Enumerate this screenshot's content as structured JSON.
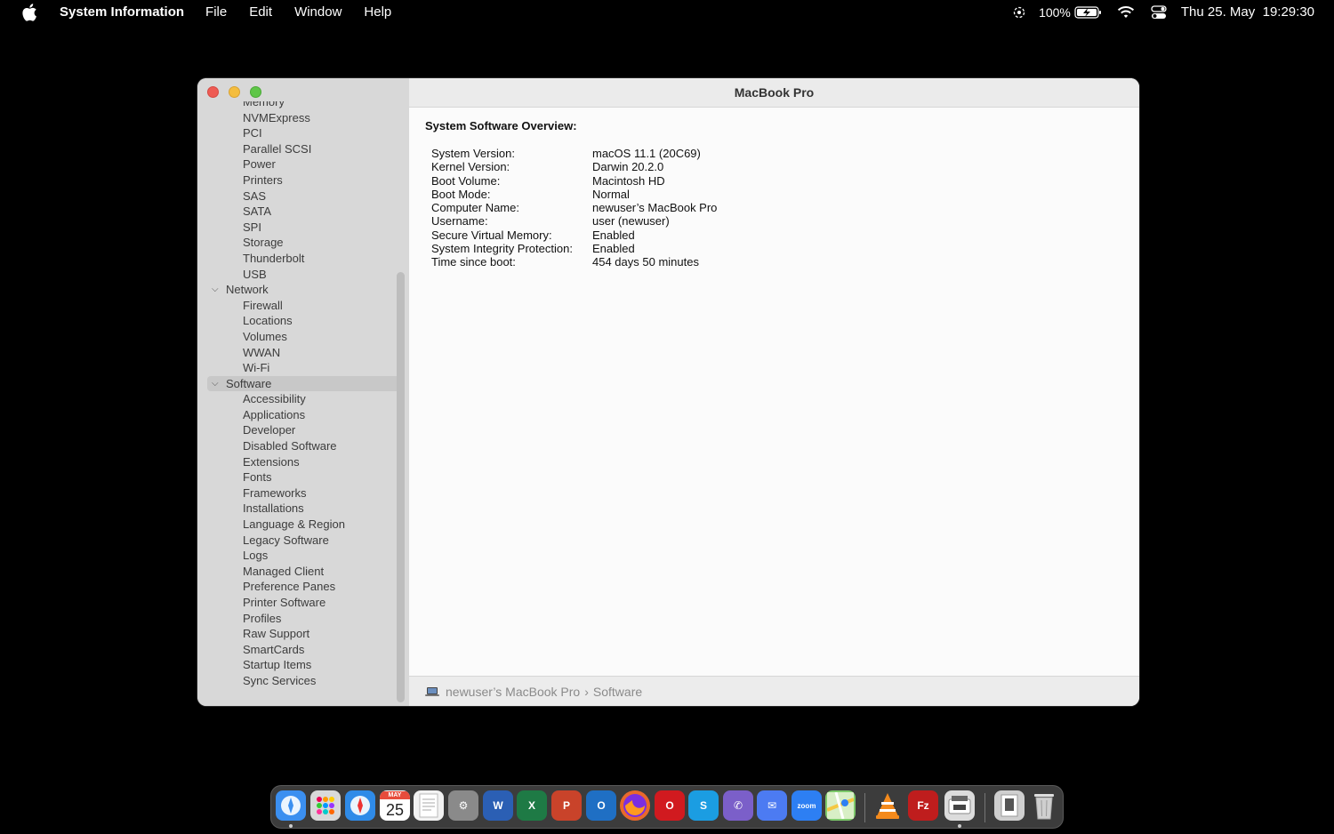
{
  "menubar": {
    "app_name": "System Information",
    "items": [
      "File",
      "Edit",
      "Window",
      "Help"
    ],
    "battery": "100%",
    "date": "Thu 25. May",
    "time": "19:29:30"
  },
  "window": {
    "title": "MacBook Pro",
    "sidebar": {
      "items": [
        {
          "label": "Memory",
          "type": "child"
        },
        {
          "label": "NVMExpress",
          "type": "child"
        },
        {
          "label": "PCI",
          "type": "child"
        },
        {
          "label": "Parallel SCSI",
          "type": "child"
        },
        {
          "label": "Power",
          "type": "child"
        },
        {
          "label": "Printers",
          "type": "child"
        },
        {
          "label": "SAS",
          "type": "child"
        },
        {
          "label": "SATA",
          "type": "child"
        },
        {
          "label": "SPI",
          "type": "child"
        },
        {
          "label": "Storage",
          "type": "child"
        },
        {
          "label": "Thunderbolt",
          "type": "child"
        },
        {
          "label": "USB",
          "type": "child"
        },
        {
          "label": "Network",
          "type": "group"
        },
        {
          "label": "Firewall",
          "type": "child"
        },
        {
          "label": "Locations",
          "type": "child"
        },
        {
          "label": "Volumes",
          "type": "child"
        },
        {
          "label": "WWAN",
          "type": "child"
        },
        {
          "label": "Wi-Fi",
          "type": "child"
        },
        {
          "label": "Software",
          "type": "group",
          "selected": true
        },
        {
          "label": "Accessibility",
          "type": "child"
        },
        {
          "label": "Applications",
          "type": "child"
        },
        {
          "label": "Developer",
          "type": "child"
        },
        {
          "label": "Disabled Software",
          "type": "child"
        },
        {
          "label": "Extensions",
          "type": "child"
        },
        {
          "label": "Fonts",
          "type": "child"
        },
        {
          "label": "Frameworks",
          "type": "child"
        },
        {
          "label": "Installations",
          "type": "child"
        },
        {
          "label": "Language & Region",
          "type": "child"
        },
        {
          "label": "Legacy Software",
          "type": "child"
        },
        {
          "label": "Logs",
          "type": "child"
        },
        {
          "label": "Managed Client",
          "type": "child"
        },
        {
          "label": "Preference Panes",
          "type": "child"
        },
        {
          "label": "Printer Software",
          "type": "child"
        },
        {
          "label": "Profiles",
          "type": "child"
        },
        {
          "label": "Raw Support",
          "type": "child"
        },
        {
          "label": "SmartCards",
          "type": "child"
        },
        {
          "label": "Startup Items",
          "type": "child"
        },
        {
          "label": "Sync Services",
          "type": "child"
        }
      ]
    },
    "content": {
      "section_title": "System Software Overview:",
      "rows": [
        {
          "key": "System Version:",
          "value": "macOS 11.1 (20C69)"
        },
        {
          "key": "Kernel Version:",
          "value": "Darwin 20.2.0"
        },
        {
          "key": "Boot Volume:",
          "value": "Macintosh HD"
        },
        {
          "key": "Boot Mode:",
          "value": "Normal"
        },
        {
          "key": "Computer Name:",
          "value": "newuser’s MacBook Pro"
        },
        {
          "key": "Username:",
          "value": "user (newuser)"
        },
        {
          "key": "Secure Virtual Memory:",
          "value": "Enabled"
        },
        {
          "key": "System Integrity Protection:",
          "value": "Enabled"
        },
        {
          "key": "Time since boot:",
          "value": "454 days 50 minutes"
        }
      ]
    },
    "path": {
      "computer": "newuser’s MacBook Pro",
      "separator": "›",
      "section": "Software"
    }
  },
  "dock": {
    "calendar_month": "MAY",
    "calendar_day": "25",
    "apps": [
      {
        "name": "finder-icon",
        "bg": "#3b8ff0",
        "glyph": "",
        "running": true
      },
      {
        "name": "launchpad-icon",
        "bg": "#d9d9d9",
        "glyph": ""
      },
      {
        "name": "safari-icon",
        "bg": "#2f8be8",
        "glyph": ""
      },
      {
        "name": "calendar-icon",
        "bg": "#ffffff",
        "glyph": ""
      },
      {
        "name": "textedit-icon",
        "bg": "#f2f2f2",
        "glyph": ""
      },
      {
        "name": "system-preferences-icon",
        "bg": "#8a8a8a",
        "glyph": "⚙"
      },
      {
        "name": "word-icon",
        "bg": "#2b5fb4",
        "glyph": "W"
      },
      {
        "name": "excel-icon",
        "bg": "#1e7a45",
        "glyph": "X"
      },
      {
        "name": "powerpoint-icon",
        "bg": "#c9432a",
        "glyph": "P"
      },
      {
        "name": "outlook-icon",
        "bg": "#1f6fc4",
        "glyph": "O"
      },
      {
        "name": "firefox-icon",
        "bg": "#e8692b",
        "glyph": ""
      },
      {
        "name": "opera-icon",
        "bg": "#d11a1f",
        "glyph": "O"
      },
      {
        "name": "skype-icon",
        "bg": "#1b9de2",
        "glyph": "S"
      },
      {
        "name": "viber-icon",
        "bg": "#7b5fc9",
        "glyph": "✆"
      },
      {
        "name": "messenger-icon",
        "bg": "#4c7bf2",
        "glyph": "✉"
      },
      {
        "name": "zoom-icon",
        "bg": "#2d7ff3",
        "glyph": "zoom"
      },
      {
        "name": "maps-icon",
        "bg": "#7cc96a",
        "glyph": ""
      },
      {
        "name": "vlc-icon",
        "bg": "transparent",
        "glyph": ""
      },
      {
        "name": "filezilla-icon",
        "bg": "#bf1d1d",
        "glyph": "Fz"
      },
      {
        "name": "system-information-icon",
        "bg": "#dcdcdc",
        "glyph": "",
        "running": true
      },
      {
        "name": "downloads-stack-icon",
        "bg": "#cfcfcf",
        "glyph": ""
      },
      {
        "name": "trash-icon",
        "bg": "transparent",
        "glyph": ""
      }
    ]
  }
}
